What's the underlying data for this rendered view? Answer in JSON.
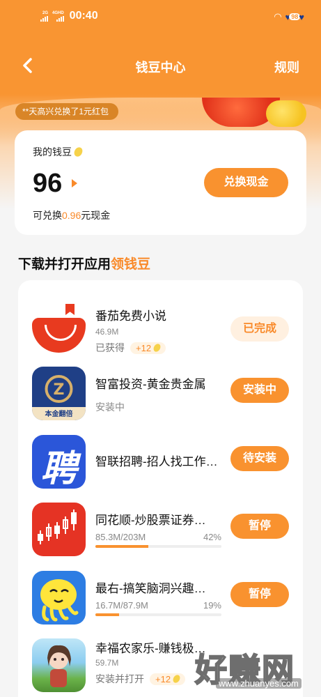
{
  "status_bar": {
    "network1": "2G",
    "network2": "4GHD",
    "time": "00:40",
    "battery": "98"
  },
  "nav": {
    "title": "钱豆中心",
    "rules": "规则"
  },
  "ticker": "**天高兴兑换了1元红包",
  "bean_card": {
    "label": "我的钱豆",
    "value": "96",
    "exchange_button": "兑换现金",
    "note_prefix": "可兑换",
    "note_amount": "0.96",
    "note_suffix": "元现金"
  },
  "section": {
    "title": "下载并打开应用",
    "highlight": "领钱豆"
  },
  "apps": [
    {
      "name": "番茄免费小说",
      "size": "46.9M",
      "status": "已获得",
      "reward": "+12",
      "button": "已完成"
    },
    {
      "name": "智富投资-黄金贵金属",
      "status": "安装中",
      "button": "安装中",
      "icon_caption": "本金翻倍"
    },
    {
      "name": "智联招聘-招人找工作…",
      "button": "待安装",
      "icon_glyph": "聘"
    },
    {
      "name": "同花顺-炒股票证券…",
      "size": "85.3M/203M",
      "percent": "42%",
      "progress": 0.42,
      "button": "暂停"
    },
    {
      "name": "最右-搞笑脑洞兴趣…",
      "size": "16.7M/87.9M",
      "percent": "19%",
      "progress": 0.19,
      "button": "暂停"
    },
    {
      "name": "幸福农家乐-赚钱极…",
      "size": "59.7M",
      "status": "安装并打开",
      "reward": "+12"
    }
  ],
  "watermark": {
    "big": "好赚网",
    "small": "www.zhuanyes.com"
  },
  "colors": {
    "accent": "#f9922f",
    "bg": "#f5f5f5"
  }
}
